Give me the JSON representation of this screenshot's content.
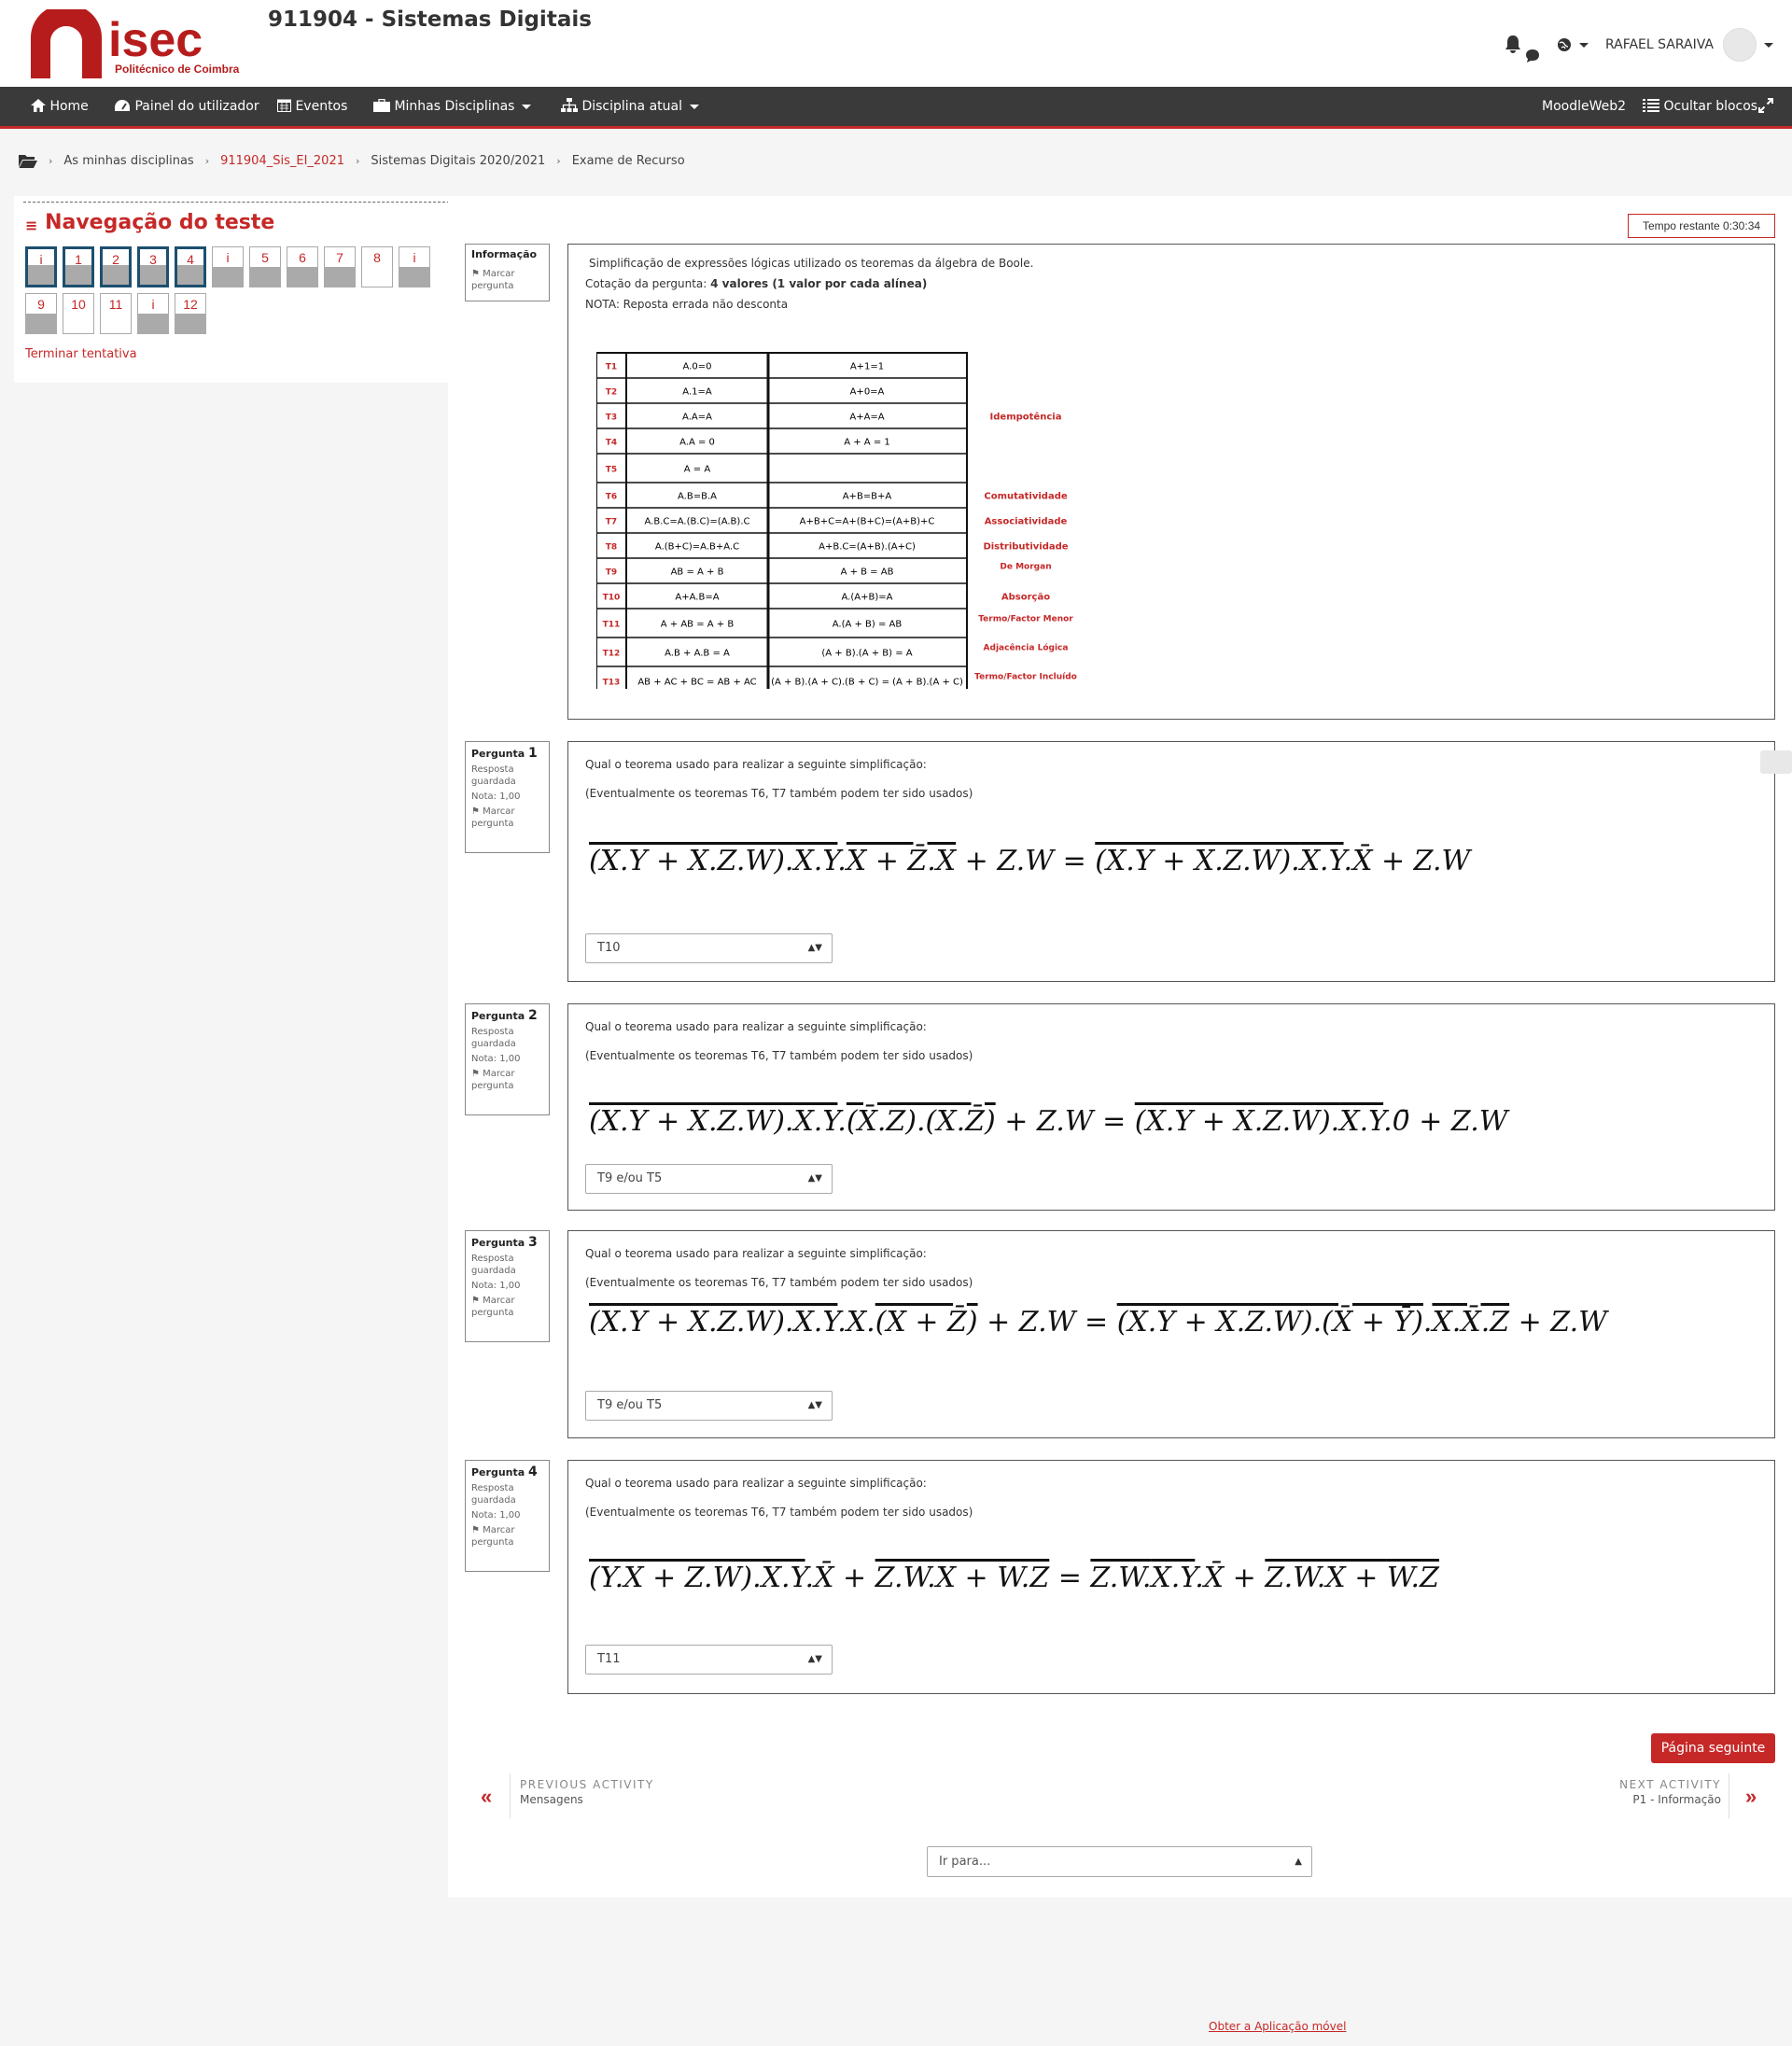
{
  "header": {
    "logo_text": "isec",
    "logo_sub": "Politécnico de Coimbra",
    "site_title": "911904 - Sistemas Digitais",
    "username": "RAFAEL SARAIVA",
    "bell_icon": "bell-icon",
    "chat_icon": "chat-icon",
    "lang_icon": "globe-icon"
  },
  "nav": {
    "items": [
      {
        "label": "Home",
        "icon": "home-icon"
      },
      {
        "label": "Painel do utilizador",
        "icon": "dashboard-icon"
      },
      {
        "label": "Eventos",
        "icon": "calendar-icon"
      },
      {
        "label": "Minhas Disciplinas",
        "icon": "briefcase-icon"
      },
      {
        "label": "Disciplina atual",
        "icon": "sitemap-icon"
      }
    ],
    "moodle": "MoodleWeb2",
    "hide_blocks": "Ocultar blocos"
  },
  "breadcrumb": [
    "As minhas disciplinas",
    "911904_Sis_EI_2021",
    "Sistemas Digitais 2020/2021",
    "Exame de Recurso"
  ],
  "quiz_nav": {
    "title": "Navegação do teste",
    "buttons": [
      {
        "label": "i",
        "state": "answered",
        "current": true
      },
      {
        "label": "1",
        "state": "answered",
        "current": true
      },
      {
        "label": "2",
        "state": "answered",
        "current": true
      },
      {
        "label": "3",
        "state": "answered",
        "current": true
      },
      {
        "label": "4",
        "state": "answered",
        "current": true
      },
      {
        "label": "i",
        "state": "answered",
        "current": false
      },
      {
        "label": "5",
        "state": "answered",
        "current": false
      },
      {
        "label": "6",
        "state": "answered",
        "current": false
      },
      {
        "label": "7",
        "state": "answered",
        "current": false
      },
      {
        "label": "8",
        "state": "empty",
        "current": false
      },
      {
        "label": "i",
        "state": "answered",
        "current": false
      },
      {
        "label": "9",
        "state": "answered",
        "current": false
      },
      {
        "label": "10",
        "state": "empty",
        "current": false
      },
      {
        "label": "11",
        "state": "empty",
        "current": false
      },
      {
        "label": "i",
        "state": "answered",
        "current": false
      },
      {
        "label": "12",
        "state": "answered",
        "current": false
      }
    ],
    "finish": "Terminar tentativa"
  },
  "timer": "Tempo restante 0:30:34",
  "info_block": {
    "title": "Informação",
    "flag": "Marcar pergunta",
    "text1": "Simplificação de expressões lógicas utilizado os teoremas da álgebra de Boole.",
    "text2_prefix": "Cotação da pergunta: ",
    "text2_bold": "4 valores (1 valor por cada alínea)",
    "text3": "NOTA: Reposta errada não desconta"
  },
  "theorems": [
    {
      "id": "T1",
      "a": "A.0=0",
      "b": "A+1=1",
      "name": ""
    },
    {
      "id": "T2",
      "a": "A.1=A",
      "b": "A+0=A",
      "name": ""
    },
    {
      "id": "T3",
      "a": "A.A=A",
      "b": "A+A=A",
      "name": "Idempotência"
    },
    {
      "id": "T4",
      "a": "A.A = 0",
      "b": "A + A = 1",
      "name": ""
    },
    {
      "id": "T5",
      "a": "A = A",
      "b": "",
      "name": ""
    },
    {
      "id": "T6",
      "a": "A.B=B.A",
      "b": "A+B=B+A",
      "name": "Comutatividade"
    },
    {
      "id": "T7",
      "a": "A.B.C=A.(B.C)=(A.B).C",
      "b": "A+B+C=A+(B+C)=(A+B)+C",
      "name": "Associatividade"
    },
    {
      "id": "T8",
      "a": "A.(B+C)=A.B+A.C",
      "b": "A+B.C=(A+B).(A+C)",
      "name": "Distributividade"
    },
    {
      "id": "T9",
      "a": "AB = A + B",
      "b": "A + B = AB",
      "name": "De Morgan"
    },
    {
      "id": "T10",
      "a": "A+A.B=A",
      "b": "A.(A+B)=A",
      "name": "Absorção"
    },
    {
      "id": "T11",
      "a": "A + AB = A + B",
      "b": "A.(A + B) = AB",
      "name": "Termo/Factor Menor"
    },
    {
      "id": "T12",
      "a": "A.B + A.B = A",
      "b": "(A + B).(A + B) = A",
      "name": "Adjacência Lógica"
    },
    {
      "id": "T13",
      "a": "AB + AC + BC = AB + AC",
      "b": "(A + B).(A + C).(B + C) = (A + B).(A + C)",
      "name": "Termo/Factor Incluído"
    }
  ],
  "questions": [
    {
      "label": "Pergunta",
      "num": "1",
      "status": "Resposta guardada",
      "grade": "Nota: 1,00",
      "flag": "Marcar pergunta",
      "text": "Qual o teorema usado para realizar a seguinte simplificação:",
      "note": "(Eventualmente os teoremas T6, T7 também podem ter sido usados)",
      "answer": "T10"
    },
    {
      "label": "Pergunta",
      "num": "2",
      "status": "Resposta guardada",
      "grade": "Nota: 1,00",
      "flag": "Marcar pergunta",
      "text": "Qual o teorema usado para realizar a seguinte simplificação:",
      "note": "(Eventualmente os teoremas T6, T7 também podem ter sido usados)",
      "answer": "T9 e/ou T5"
    },
    {
      "label": "Pergunta",
      "num": "3",
      "status": "Resposta guardada",
      "grade": "Nota: 1,00",
      "flag": "Marcar pergunta",
      "text": "Qual o teorema usado para realizar a seguinte simplificação:",
      "note": "(Eventualmente os teoremas T6, T7 também podem ter sido usados)",
      "answer": "T9 e/ou T5"
    },
    {
      "label": "Pergunta",
      "num": "4",
      "status": "Resposta guardada",
      "grade": "Nota: 1,00",
      "flag": "Marcar pergunta",
      "text": "Qual o teorema usado para realizar a seguinte simplificação:",
      "note": "(Eventualmente os teoremas T6, T7 também podem ter sido usados)",
      "answer": "T11"
    }
  ],
  "next_page": "Página seguinte",
  "activity_nav": {
    "prev_label": "PREVIOUS ACTIVITY",
    "prev_name": "Mensagens",
    "next_label": "NEXT ACTIVITY",
    "next_name": "P1 - Informação"
  },
  "jump": "Ir para...",
  "footer": "Obter a Aplicação móvel",
  "colors": {
    "accent": "#c62828",
    "nav_bg": "#3a3a3a",
    "current_border": "#1d4f6f"
  }
}
